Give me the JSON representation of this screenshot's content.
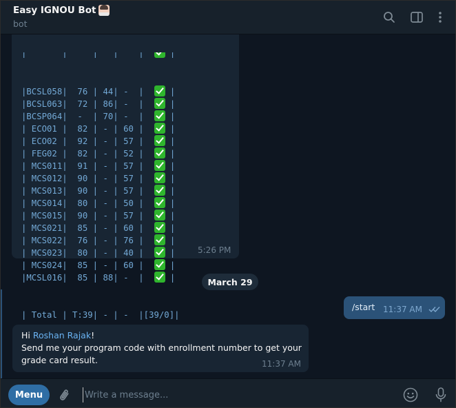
{
  "header": {
    "title": "Easy IGNOU Bot",
    "subtitle": "bot"
  },
  "grade_table": {
    "rows": [
      "|BCSL058|  76 | 44| -  |  ",
      "|BCSL063|  72 | 86| -  |  ",
      "|BCSP064|  -  | 70| -  |  ",
      "| ECO01 |  82 | - | 60 |  ",
      "| ECO02 |  92 | - | 57 |  ",
      "| FEG02 |  82 | - | 52 |  ",
      "| MCS011|  91 | - | 57 |  ",
      "| MCS012|  90 | - | 57 |  ",
      "| MCS013|  90 | - | 57 |  ",
      "| MCS014|  80 | - | 50 |  ",
      "| MCS015|  90 | - | 57 |  ",
      "| MCS021|  85 | - | 60 |  ",
      "| MCS022|  76 | - | 76 |  ",
      "| MCS023|  80 | - | 40 |  ",
      "| MCS024|  85 | - | 60 |  ",
      "|MCSL016|  85 | 88| -  |  "
    ],
    "row_end": " |",
    "total_row": "| Total | T:39| - | -  |[39/0]|",
    "border_row": "+-------+-----+---+----+------+",
    "time": "5:26 PM"
  },
  "date_separator": "March 29",
  "outgoing": {
    "text": "/start",
    "time": "11:37 AM"
  },
  "incoming": {
    "greeting": "Hi ",
    "name": "Roshan Rajak",
    "exclaim": "!",
    "body": "Send me your program code with enrollment number to get your grade card result.",
    "time": "11:37 AM"
  },
  "composer": {
    "menu_label": "Menu",
    "placeholder": "Write a message..."
  },
  "colors": {
    "accent": "#2f6ea5",
    "background": "#0e1621",
    "bubble_in": "#182533",
    "bubble_out": "#2b5278",
    "check_green": "#2fb52d"
  },
  "icons": [
    "search-icon",
    "sidebar-toggle-icon",
    "more-vertical-icon",
    "attach-icon",
    "emoji-icon",
    "microphone-icon",
    "double-check-icon",
    "check-mark-icon"
  ]
}
